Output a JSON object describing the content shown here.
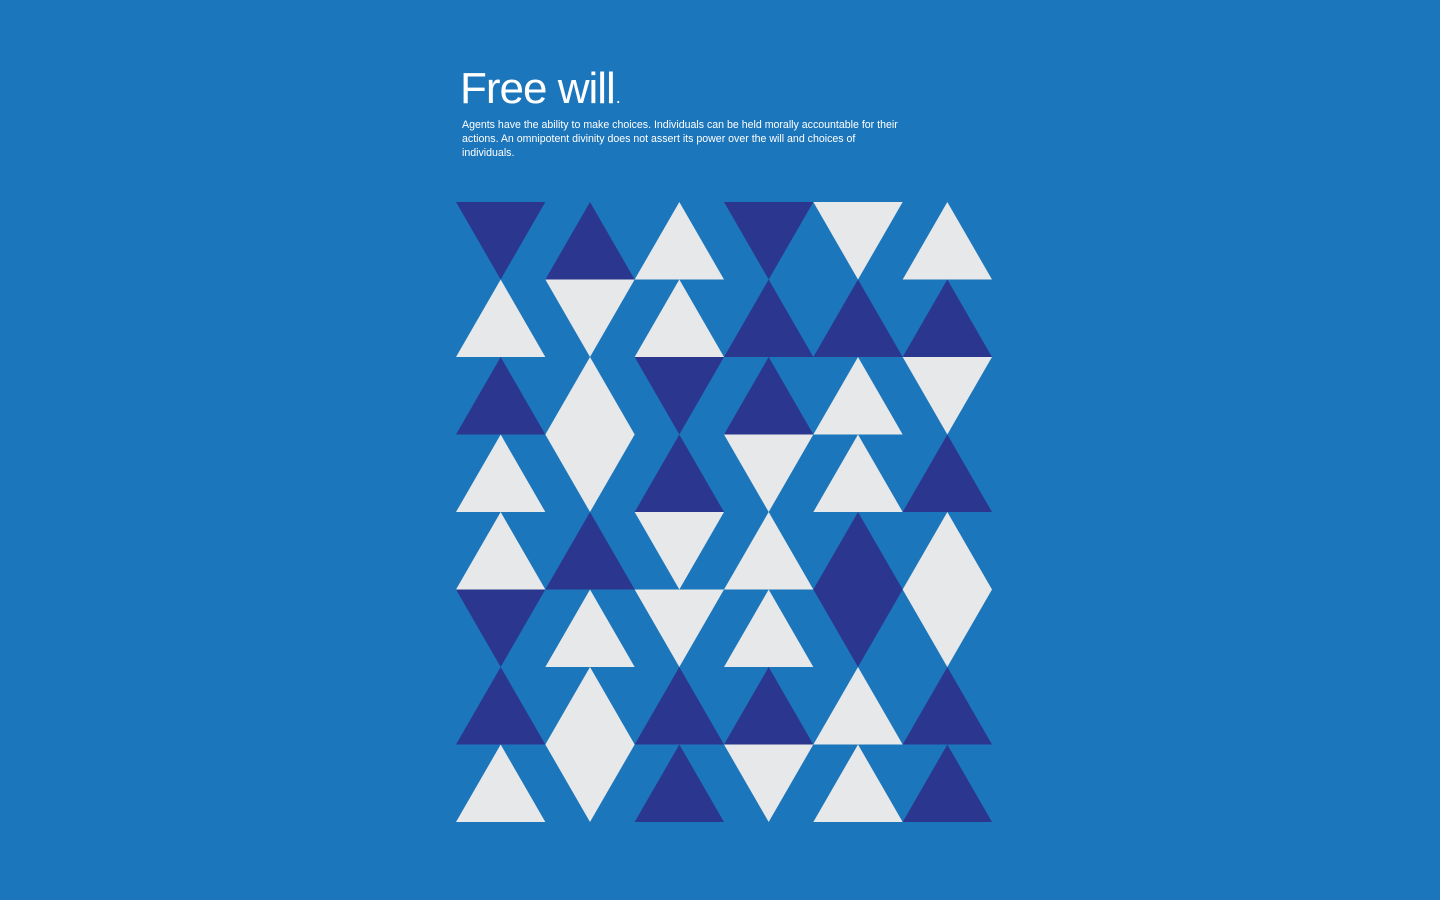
{
  "poster": {
    "title": "Free will",
    "title_period": ".",
    "description": "Agents have the ability to make choices. Individuals can be held morally accountable for their actions. An omnipotent divinity does not assert its power over the will and choices of individuals."
  },
  "colors": {
    "background": "#1c76bb",
    "light": "#e6e8ea",
    "dark": "#2b378f",
    "text": "#ffffff"
  },
  "pattern": {
    "columns": 6,
    "rows": 8,
    "tiles": [
      [
        "dark-down",
        "dark-up",
        "light-up",
        "dark-down",
        "light-down",
        "light-up"
      ],
      [
        "light-up",
        "light-down",
        "light-up",
        "dark-up",
        "dark-up",
        "dark-up"
      ],
      [
        "dark-up",
        "light-up",
        "dark-down",
        "dark-up",
        "light-up",
        "light-down"
      ],
      [
        "light-up",
        "light-down",
        "dark-up",
        "light-down",
        "light-up",
        "dark-up"
      ],
      [
        "light-up",
        "dark-up",
        "light-down",
        "light-up",
        "dark-up",
        "light-up"
      ],
      [
        "dark-down",
        "light-up",
        "light-down",
        "light-up",
        "dark-down",
        "light-down"
      ],
      [
        "dark-up",
        "light-up",
        "dark-up",
        "dark-up",
        "light-up",
        "dark-up"
      ],
      [
        "light-up",
        "light-down",
        "dark-up",
        "light-down",
        "light-up",
        "dark-up"
      ]
    ]
  }
}
